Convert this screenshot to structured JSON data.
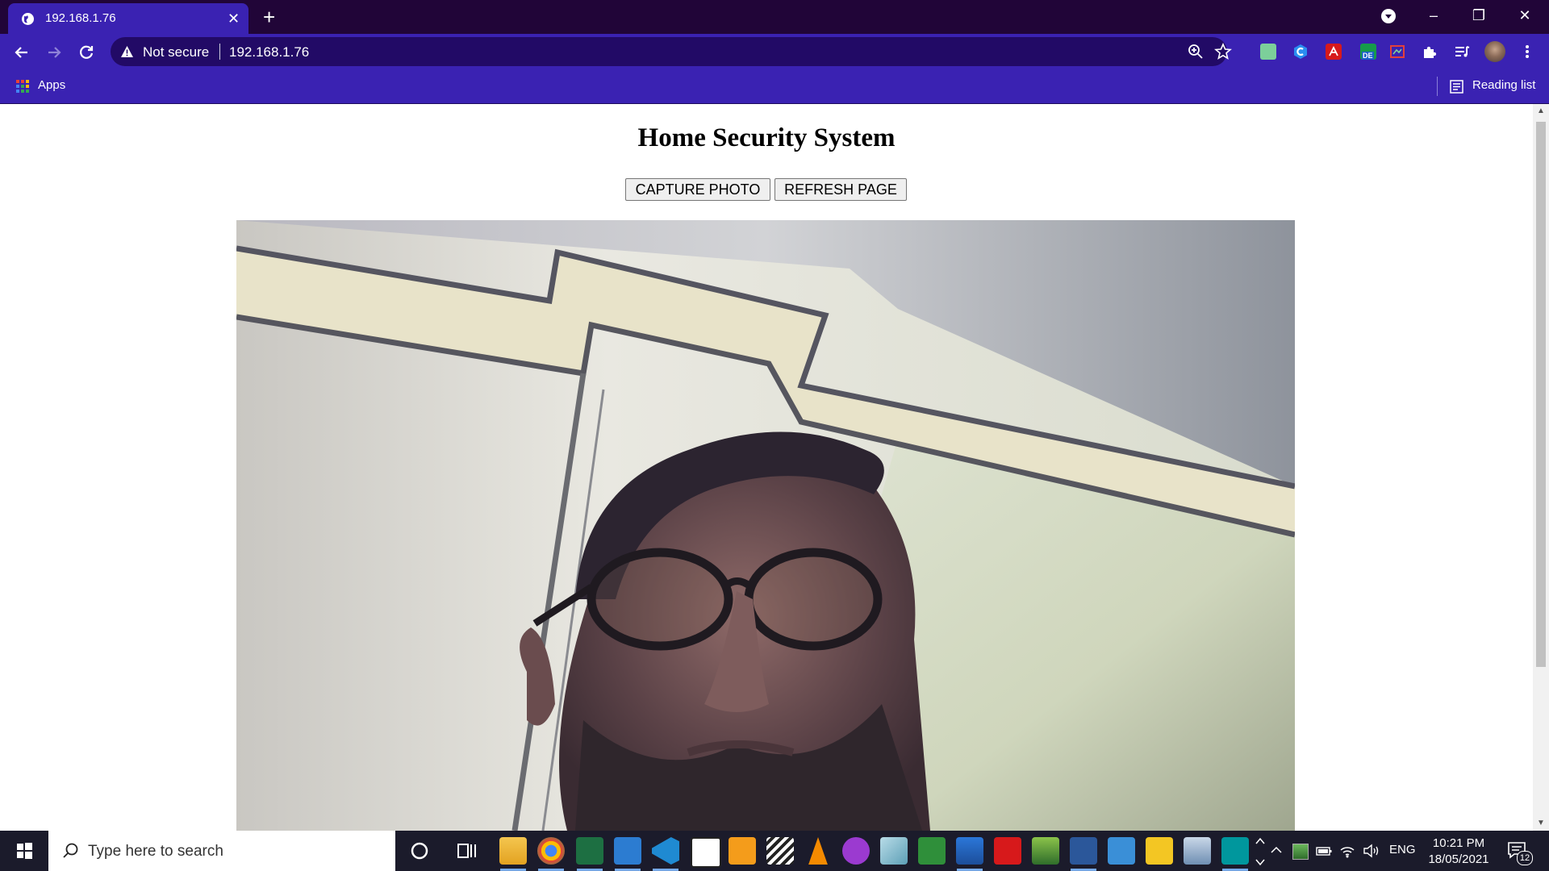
{
  "browser": {
    "tab_title": "192.168.1.76",
    "tab_close": "✕",
    "new_tab": "+",
    "security_label": "Not secure",
    "url": "192.168.1.76",
    "bookmarks": {
      "apps_label": "Apps",
      "reading_list_label": "Reading list"
    },
    "window_controls": {
      "minimize": "–",
      "restore": "❐",
      "close": "✕"
    },
    "extensions": [
      "mail-ext-icon",
      "c-ext-icon",
      "pdf-ext-icon",
      "de-ext-icon",
      "screen-ext-icon",
      "puzzle-icon",
      "media-icon",
      "profile-avatar"
    ],
    "de_badge": "DE",
    "colors": {
      "tabstrip": "#210538",
      "toolbar": "#3a22b2",
      "omnibox": "#220a66"
    }
  },
  "page": {
    "title": "Home Security System",
    "capture_button": "CAPTURE PHOTO",
    "refresh_button": "REFRESH PAGE",
    "camera_feed_icon": "camera-feed-image"
  },
  "taskbar": {
    "search_placeholder": "Type here to search",
    "apps": [
      "file-explorer-icon",
      "chrome-icon",
      "excel-icon",
      "mail-icon",
      "vscode-icon",
      "notion-icon",
      "sublime-icon",
      "clapper-icon",
      "vlc-icon",
      "podcast-icon",
      "tablet-icon",
      "vs-icon",
      "photos-icon",
      "acrobat-icon",
      "photo-editor-icon",
      "word-icon",
      "mx-icon",
      "typora-icon",
      "printer-icon",
      "arduino-icon"
    ],
    "language": "ENG",
    "time": "10:21 PM",
    "date": "18/05/2021",
    "notification_count": "12"
  }
}
